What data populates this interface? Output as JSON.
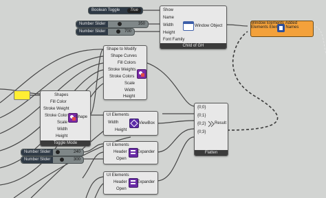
{
  "toggle": {
    "label": "Boolean Toggle",
    "value": "True"
  },
  "sliders": [
    {
      "label": "Number Slider",
      "value": "350"
    },
    {
      "label": "Number Slider",
      "value": "700"
    },
    {
      "label": "Number Slider",
      "value": "240"
    },
    {
      "label": "Number Slider",
      "value": "300"
    }
  ],
  "window_node": {
    "inputs": [
      "Show",
      "Name",
      "Width",
      "Height",
      "Font Family"
    ],
    "label": "Window Object",
    "footer": "Child of GH"
  },
  "add_node": {
    "inputs": [
      "Window",
      "Elements"
    ],
    "outputs": [
      "Added Elements",
      "Element Names"
    ]
  },
  "shape_mod_node": {
    "inputs": [
      "Shape to Modify",
      "Shape Curves",
      "Fill Colors",
      "Stroke Weights",
      "Stroke Colors",
      "Scale",
      "Width",
      "Height"
    ]
  },
  "shapes_node": {
    "inputs": [
      "Shapes",
      "Fill Color",
      "Stroke Weight",
      "Stroke Color",
      "Scale",
      "Width",
      "Height"
    ],
    "output": "Shape",
    "footer": "Toggle Mode"
  },
  "viewbox_node": {
    "inputs": [
      "UI Elements",
      "Width",
      "Height"
    ],
    "output": "ViewBox"
  },
  "expander1": {
    "inputs": [
      "UI Elements",
      "Header",
      "Open"
    ],
    "output": "Expander"
  },
  "expander2": {
    "inputs": [
      "UI Elements",
      "Header",
      "Open"
    ],
    "output": "Expander"
  },
  "flatten_node": {
    "inputs": [
      "{0;0}",
      "{0;1}",
      "{0;2}",
      "{0;3}"
    ],
    "output": "Result",
    "footer": "Flatten"
  },
  "colors": {
    "canvas": "#d2d4d2",
    "wire": "#4a4a4a",
    "orange": "#f3a13b",
    "yellow": "#ffee33"
  },
  "icons": [
    "window-icon",
    "add-elements-icon",
    "shape-icon",
    "viewbox-icon",
    "expander-icon",
    "flatten-icon"
  ]
}
